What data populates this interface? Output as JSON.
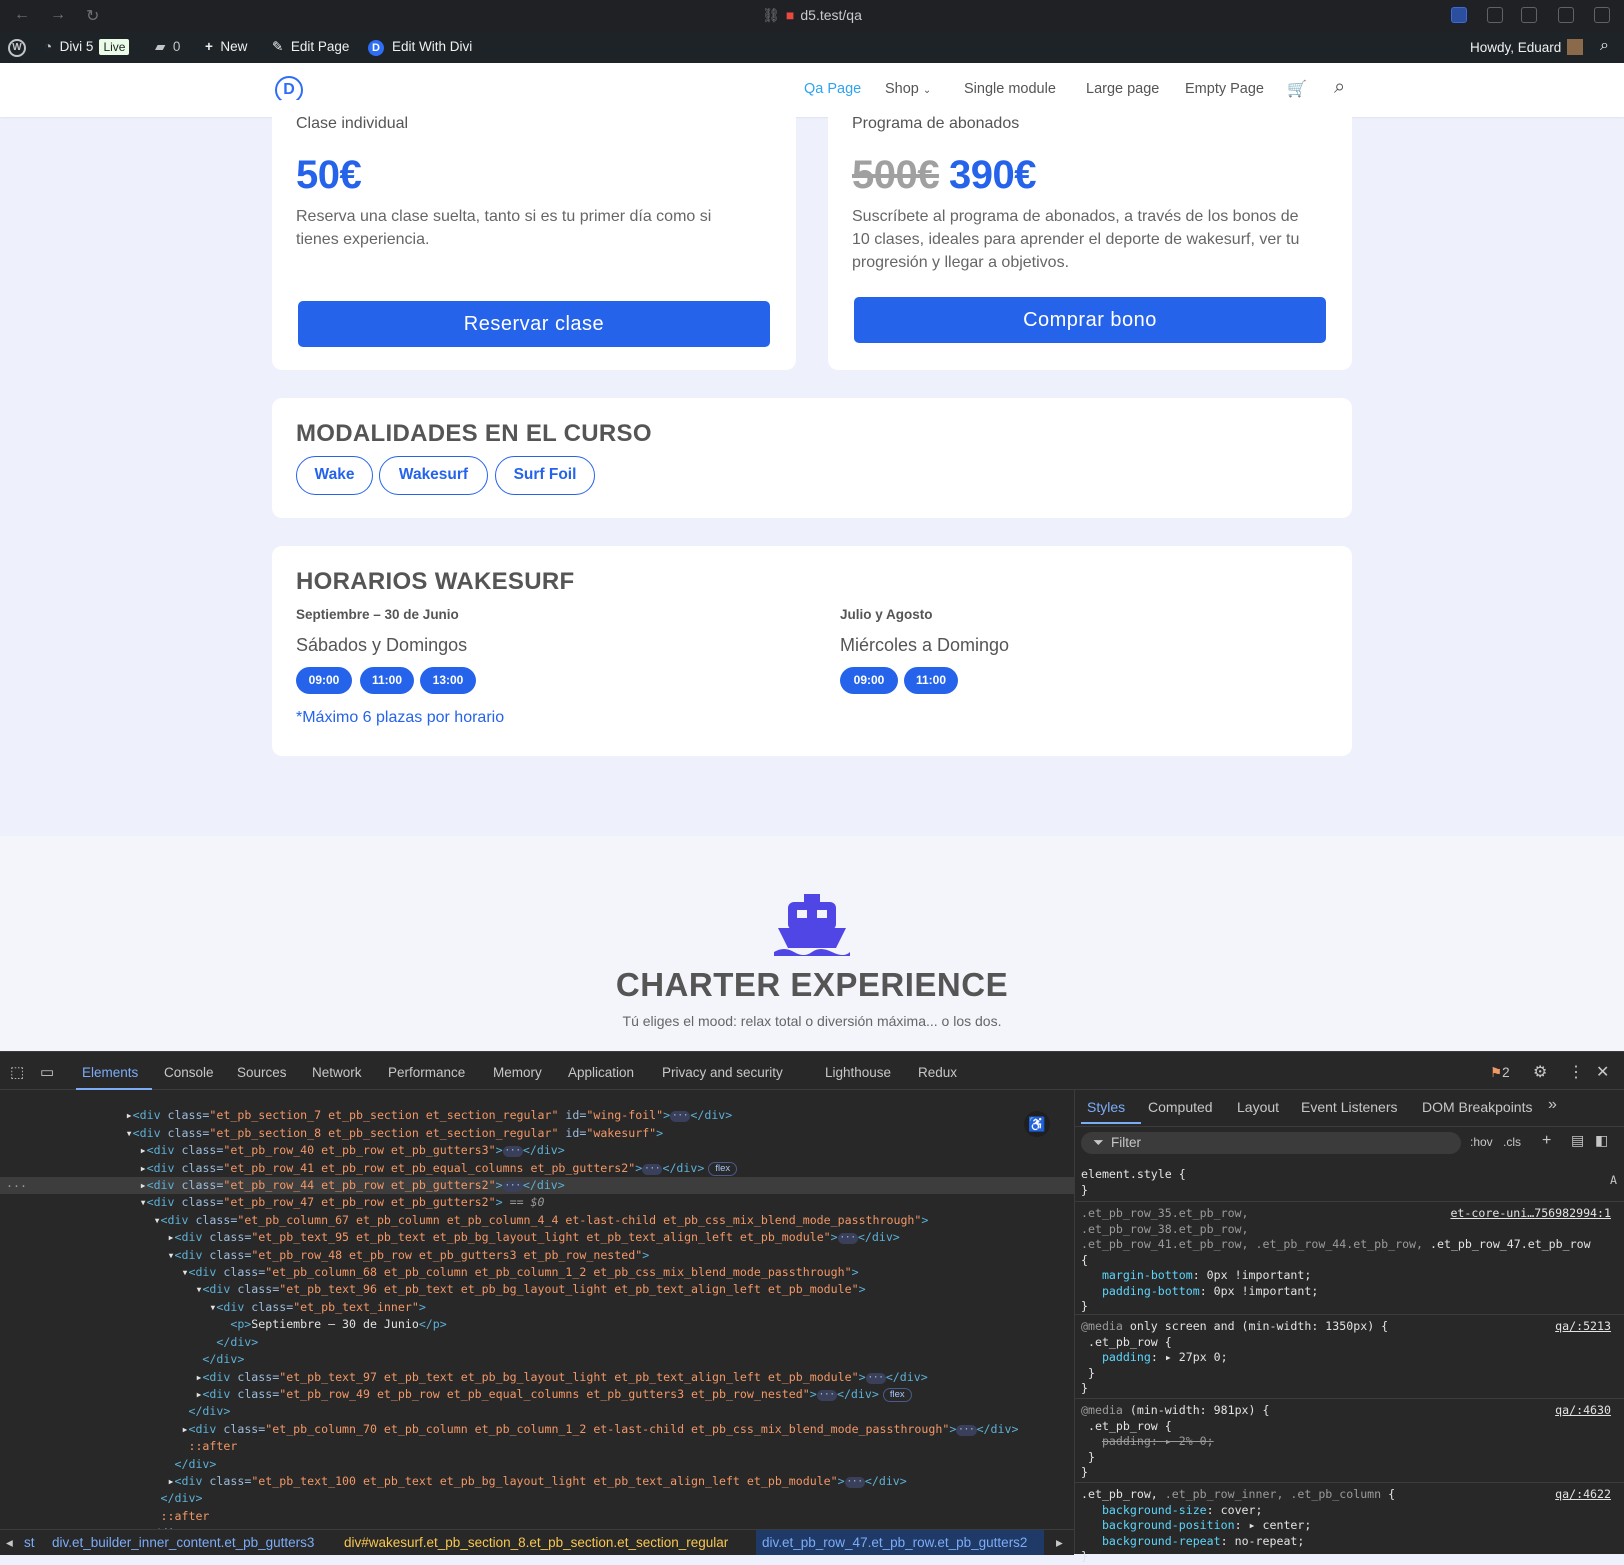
{
  "browser": {
    "url": "d5.test/qa"
  },
  "adminbar": {
    "site": "Divi 5",
    "live": "Live",
    "comments": "0",
    "new": "New",
    "edit_page": "Edit Page",
    "edit_divi": "Edit With Divi",
    "howdy": "Howdy, Eduard"
  },
  "header": {
    "logo_letter": "D",
    "menu": [
      "Qa Page",
      "Shop",
      "Single module",
      "Large page",
      "Empty Page"
    ]
  },
  "card1": {
    "subtitle": "Clase individual",
    "price": "50€",
    "desc1": "Reserva una clase suelta, tanto si es tu primer día como si",
    "desc2": "tienes experiencia.",
    "button": "Reservar clase"
  },
  "card2": {
    "subtitle": "Programa de abonados",
    "old_price": "500€",
    "price": "390€",
    "desc1": "Suscríbete al programa de abonados, a través de los bonos de",
    "desc2": "10 clases, ideales para aprender el deporte de wakesurf, ver tu",
    "desc3": "progresión y llegar a objetivos.",
    "button": "Comprar bono"
  },
  "modalidades": {
    "title": "MODALIDADES EN EL CURSO",
    "pills": [
      "Wake",
      "Wakesurf",
      "Surf Foil"
    ]
  },
  "horarios": {
    "title": "HORARIOS WAKESURF",
    "col1_period": "Septiembre – 30 de Junio",
    "col1_days": "Sábados y Domingos",
    "col1_times": [
      "09:00",
      "11:00",
      "13:00"
    ],
    "col2_period": "Julio y Agosto",
    "col2_days": "Miércoles a Domingo",
    "col2_times": [
      "09:00",
      "11:00"
    ],
    "note": "*Máximo 6 plazas por horario"
  },
  "charter": {
    "title": "CHARTER EXPERIENCE",
    "subtitle": "Tú eliges el mood: relax total o diversión máxima... o los dos.",
    "icon": "ship-icon"
  },
  "devtools": {
    "tabs": [
      "Elements",
      "Console",
      "Sources",
      "Network",
      "Performance",
      "Memory",
      "Application",
      "Privacy and security",
      "Lighthouse",
      "Redux"
    ],
    "issues_count": "2",
    "sub_tabs": [
      "Styles",
      "Computed",
      "Layout",
      "Event Listeners",
      "DOM Breakpoints"
    ],
    "filter_placeholder": "Filter",
    "hov": ":hov",
    "cls": ".cls",
    "breadcrumbs": [
      "st",
      "div.et_builder_inner_content.et_pb_gutters3",
      "div#wakesurf.et_pb_section_8.et_pb_section.et_section_regular",
      "div.et_pb_row_47.et_pb_row.et_pb_gutters2"
    ],
    "sources": [
      "et-core-uni…756982994:1",
      "qa/:5213",
      "qa/:4630",
      "qa/:4622"
    ],
    "text_p": "Septiembre – 30 de Junio"
  }
}
